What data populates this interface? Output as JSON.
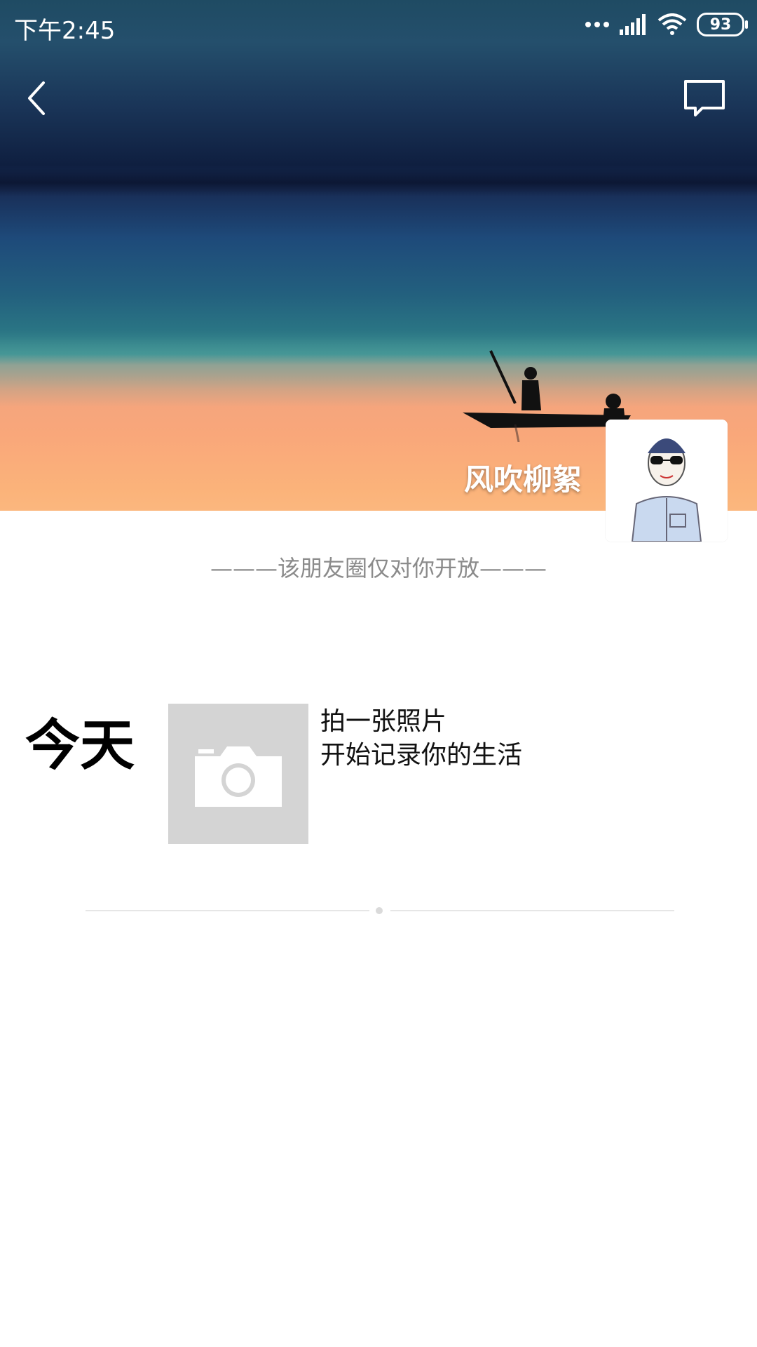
{
  "status_bar": {
    "time": "下午2:45",
    "battery": "93",
    "icons": [
      "dots-icon",
      "signal-icon",
      "wifi-icon",
      "battery-icon"
    ]
  },
  "nav": {
    "back_icon": "chevron-left-icon",
    "message_icon": "message-icon"
  },
  "profile": {
    "username": "风吹柳絮"
  },
  "visibility_note": "———该朋友圈仅对你开放———",
  "post": {
    "date_label": "今天",
    "prompt_line1": "拍一张照片",
    "prompt_line2": "开始记录你的生活",
    "camera_icon": "camera-icon"
  },
  "colors": {
    "cover_sky": "#1a3558",
    "cover_sunset": "#f9a77a",
    "placeholder_bg": "#d4d4d4",
    "note_text": "#8b8b8b"
  }
}
